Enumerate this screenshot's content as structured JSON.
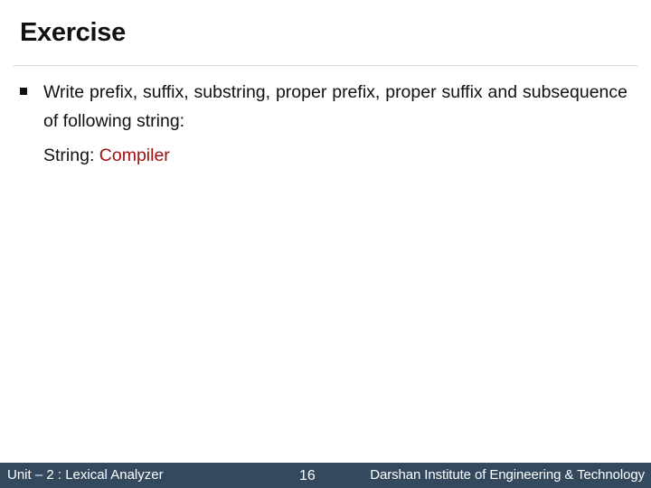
{
  "slide": {
    "title": "Exercise",
    "bullets": [
      {
        "text": "Write prefix, suffix, substring, proper prefix, proper suffix and subsequence of following string:"
      }
    ],
    "string_label": "String: ",
    "string_value": "Compiler"
  },
  "footer": {
    "unit": "Unit – 2 : Lexical Analyzer",
    "page_number": "16",
    "institute": "Darshan Institute of Engineering & Technology"
  },
  "colors": {
    "footer_bg": "#34495e",
    "highlight": "#a01010",
    "divider": "#d9d9d9"
  }
}
